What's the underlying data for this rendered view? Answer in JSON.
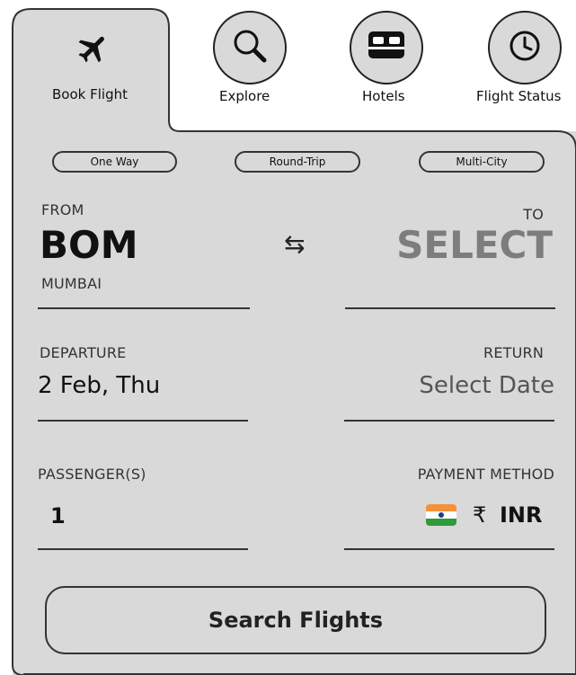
{
  "tabs": {
    "book_flight": "Book Flight",
    "explore": "Explore",
    "hotels": "Hotels",
    "flight_status": "Flight Status"
  },
  "icons": {
    "book_flight": "airplane-icon",
    "explore": "search-icon",
    "hotels": "bed-icon",
    "flight_status": "clock-icon"
  },
  "trip_types": {
    "one_way": "One Way",
    "round_trip": "Round-Trip",
    "multi_city": "Multi-City"
  },
  "from": {
    "label": "FROM",
    "code": "BOM",
    "city": "MUMBAI"
  },
  "to": {
    "label": "TO",
    "code": "SELECT"
  },
  "departure": {
    "label": "DEPARTURE",
    "value": "2 Feb, Thu"
  },
  "return": {
    "label": "RETURN",
    "value": "Select Date"
  },
  "passengers": {
    "label": "PASSENGER(S)",
    "value": "1"
  },
  "payment": {
    "label": "PAYMENT METHOD",
    "currency_symbol": "₹",
    "currency": "INR"
  },
  "search_button": "Search Flights",
  "colors": {
    "card": "#d9d9d9",
    "border": "#333333",
    "flag_saffron": "#f4923a",
    "flag_green": "#2f9a3a"
  }
}
